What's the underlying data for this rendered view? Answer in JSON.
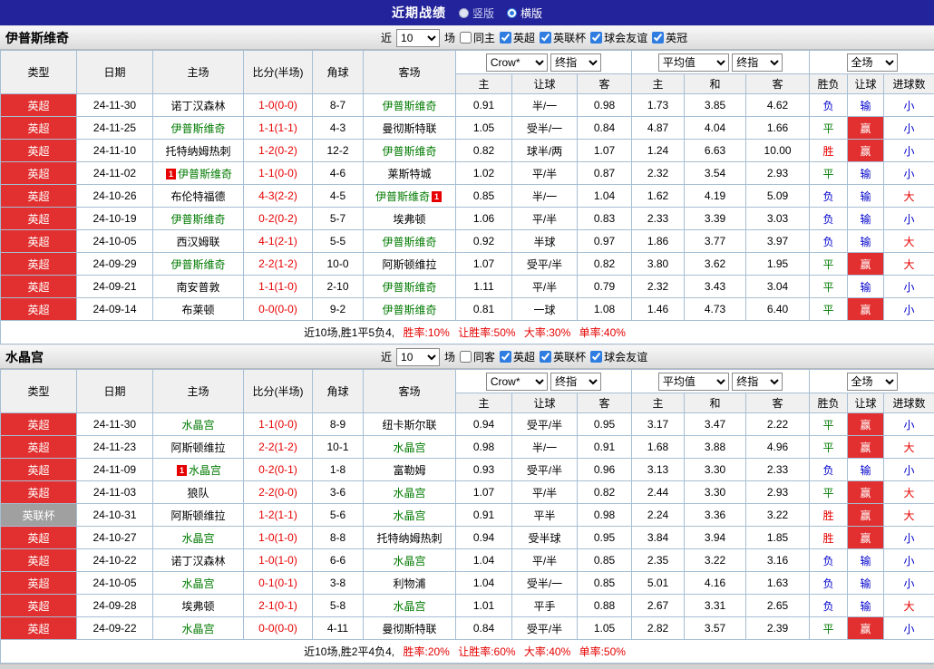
{
  "header": {
    "title": "近期战绩",
    "options": [
      {
        "label": "竖版",
        "selected": false
      },
      {
        "label": "横版",
        "selected": true
      }
    ]
  },
  "columns": [
    "类型",
    "日期",
    "主场",
    "比分(半场)",
    "角球",
    "客场",
    "主",
    "让球",
    "客",
    "主",
    "和",
    "客",
    "胜负",
    "让球",
    "进球数"
  ],
  "sections": [
    {
      "team": "伊普斯维奇",
      "filter": {
        "near_label": "近",
        "count": "10",
        "games_label": "场",
        "same_label": "同主",
        "same_checked": false,
        "leagues": [
          {
            "label": "英超",
            "checked": true
          },
          {
            "label": "英联杯",
            "checked": true
          },
          {
            "label": "球会友谊",
            "checked": true
          },
          {
            "label": "英冠",
            "checked": true
          }
        ]
      },
      "dropdowns": {
        "asia_source": "Crow*",
        "asia_type": "终指",
        "euro_source": "平均值",
        "euro_type": "终指",
        "scope": "全场"
      },
      "rows": [
        {
          "league": "英超",
          "date": "24-11-30",
          "home": "诺丁汉森林",
          "home_subject": false,
          "home_card": false,
          "score": "1-0(0-0)",
          "corner": "8-7",
          "away": "伊普斯维奇",
          "away_subject": true,
          "away_card": false,
          "asia_home": "0.91",
          "handicap": "半/一",
          "asia_away": "0.98",
          "euro_home": "1.73",
          "euro_draw": "3.85",
          "euro_away": "4.62",
          "result": "负",
          "handicap_result": "输",
          "goals": "小"
        },
        {
          "league": "英超",
          "date": "24-11-25",
          "home": "伊普斯维奇",
          "home_subject": true,
          "home_card": false,
          "score": "1-1(1-1)",
          "corner": "4-3",
          "away": "曼彻斯特联",
          "away_subject": false,
          "away_card": false,
          "asia_home": "1.05",
          "handicap": "受半/一",
          "asia_away": "0.84",
          "euro_home": "4.87",
          "euro_draw": "4.04",
          "euro_away": "1.66",
          "result": "平",
          "handicap_result": "赢",
          "goals": "小"
        },
        {
          "league": "英超",
          "date": "24-11-10",
          "home": "托特纳姆热刺",
          "home_subject": false,
          "home_card": false,
          "score": "1-2(0-2)",
          "corner": "12-2",
          "away": "伊普斯维奇",
          "away_subject": true,
          "away_card": false,
          "asia_home": "0.82",
          "handicap": "球半/两",
          "asia_away": "1.07",
          "euro_home": "1.24",
          "euro_draw": "6.63",
          "euro_away": "10.00",
          "result": "胜",
          "handicap_result": "赢",
          "goals": "小"
        },
        {
          "league": "英超",
          "date": "24-11-02",
          "home": "伊普斯维奇",
          "home_subject": true,
          "home_card": true,
          "score": "1-1(0-0)",
          "corner": "4-6",
          "away": "莱斯特城",
          "away_subject": false,
          "away_card": false,
          "asia_home": "1.02",
          "handicap": "平/半",
          "asia_away": "0.87",
          "euro_home": "2.32",
          "euro_draw": "3.54",
          "euro_away": "2.93",
          "result": "平",
          "handicap_result": "输",
          "goals": "小"
        },
        {
          "league": "英超",
          "date": "24-10-26",
          "home": "布伦特福德",
          "home_subject": false,
          "home_card": false,
          "score": "4-3(2-2)",
          "corner": "4-5",
          "away": "伊普斯维奇",
          "away_subject": true,
          "away_card": true,
          "asia_home": "0.85",
          "handicap": "半/一",
          "asia_away": "1.04",
          "euro_home": "1.62",
          "euro_draw": "4.19",
          "euro_away": "5.09",
          "result": "负",
          "handicap_result": "输",
          "goals": "大"
        },
        {
          "league": "英超",
          "date": "24-10-19",
          "home": "伊普斯维奇",
          "home_subject": true,
          "home_card": false,
          "score": "0-2(0-2)",
          "corner": "5-7",
          "away": "埃弗顿",
          "away_subject": false,
          "away_card": false,
          "asia_home": "1.06",
          "handicap": "平/半",
          "asia_away": "0.83",
          "euro_home": "2.33",
          "euro_draw": "3.39",
          "euro_away": "3.03",
          "result": "负",
          "handicap_result": "输",
          "goals": "小"
        },
        {
          "league": "英超",
          "date": "24-10-05",
          "home": "西汉姆联",
          "home_subject": false,
          "home_card": false,
          "score": "4-1(2-1)",
          "corner": "5-5",
          "away": "伊普斯维奇",
          "away_subject": true,
          "away_card": false,
          "asia_home": "0.92",
          "handicap": "半球",
          "asia_away": "0.97",
          "euro_home": "1.86",
          "euro_draw": "3.77",
          "euro_away": "3.97",
          "result": "负",
          "handicap_result": "输",
          "goals": "大"
        },
        {
          "league": "英超",
          "date": "24-09-29",
          "home": "伊普斯维奇",
          "home_subject": true,
          "home_card": false,
          "score": "2-2(1-2)",
          "corner": "10-0",
          "away": "阿斯顿维拉",
          "away_subject": false,
          "away_card": false,
          "asia_home": "1.07",
          "handicap": "受平/半",
          "asia_away": "0.82",
          "euro_home": "3.80",
          "euro_draw": "3.62",
          "euro_away": "1.95",
          "result": "平",
          "handicap_result": "赢",
          "goals": "大"
        },
        {
          "league": "英超",
          "date": "24-09-21",
          "home": "南安普敦",
          "home_subject": false,
          "home_card": false,
          "score": "1-1(1-0)",
          "corner": "2-10",
          "away": "伊普斯维奇",
          "away_subject": true,
          "away_card": false,
          "asia_home": "1.11",
          "handicap": "平/半",
          "asia_away": "0.79",
          "euro_home": "2.32",
          "euro_draw": "3.43",
          "euro_away": "3.04",
          "result": "平",
          "handicap_result": "输",
          "goals": "小"
        },
        {
          "league": "英超",
          "date": "24-09-14",
          "home": "布莱顿",
          "home_subject": false,
          "home_card": false,
          "score": "0-0(0-0)",
          "corner": "9-2",
          "away": "伊普斯维奇",
          "away_subject": true,
          "away_card": false,
          "asia_home": "0.81",
          "handicap": "一球",
          "asia_away": "1.08",
          "euro_home": "1.46",
          "euro_draw": "4.73",
          "euro_away": "6.40",
          "result": "平",
          "handicap_result": "赢",
          "goals": "小"
        }
      ],
      "summary": {
        "prefix": "近10场,胜1平5负4,",
        "win_rate": "胜率:10%",
        "handicap_rate": "让胜率:50%",
        "big_rate": "大率:30%",
        "odd_rate": "单率:40%"
      }
    },
    {
      "team": "水晶宫",
      "filter": {
        "near_label": "近",
        "count": "10",
        "games_label": "场",
        "same_label": "同客",
        "same_checked": false,
        "leagues": [
          {
            "label": "英超",
            "checked": true
          },
          {
            "label": "英联杯",
            "checked": true
          },
          {
            "label": "球会友谊",
            "checked": true
          }
        ]
      },
      "dropdowns": {
        "asia_source": "Crow*",
        "asia_type": "终指",
        "euro_source": "平均值",
        "euro_type": "终指",
        "scope": "全场"
      },
      "rows": [
        {
          "league": "英超",
          "date": "24-11-30",
          "home": "水晶宫",
          "home_subject": true,
          "home_card": false,
          "score": "1-1(0-0)",
          "corner": "8-9",
          "away": "纽卡斯尔联",
          "away_subject": false,
          "away_card": false,
          "asia_home": "0.94",
          "handicap": "受平/半",
          "asia_away": "0.95",
          "euro_home": "3.17",
          "euro_draw": "3.47",
          "euro_away": "2.22",
          "result": "平",
          "handicap_result": "赢",
          "goals": "小"
        },
        {
          "league": "英超",
          "date": "24-11-23",
          "home": "阿斯顿维拉",
          "home_subject": false,
          "home_card": false,
          "score": "2-2(1-2)",
          "corner": "10-1",
          "away": "水晶宫",
          "away_subject": true,
          "away_card": false,
          "asia_home": "0.98",
          "handicap": "半/一",
          "asia_away": "0.91",
          "euro_home": "1.68",
          "euro_draw": "3.88",
          "euro_away": "4.96",
          "result": "平",
          "handicap_result": "赢",
          "goals": "大"
        },
        {
          "league": "英超",
          "date": "24-11-09",
          "home": "水晶宫",
          "home_subject": true,
          "home_card": true,
          "score": "0-2(0-1)",
          "corner": "1-8",
          "away": "富勒姆",
          "away_subject": false,
          "away_card": false,
          "asia_home": "0.93",
          "handicap": "受平/半",
          "asia_away": "0.96",
          "euro_home": "3.13",
          "euro_draw": "3.30",
          "euro_away": "2.33",
          "result": "负",
          "handicap_result": "输",
          "goals": "小"
        },
        {
          "league": "英超",
          "date": "24-11-03",
          "home": "狼队",
          "home_subject": false,
          "home_card": false,
          "score": "2-2(0-0)",
          "corner": "3-6",
          "away": "水晶宫",
          "away_subject": true,
          "away_card": false,
          "asia_home": "1.07",
          "handicap": "平/半",
          "asia_away": "0.82",
          "euro_home": "2.44",
          "euro_draw": "3.30",
          "euro_away": "2.93",
          "result": "平",
          "handicap_result": "赢",
          "goals": "大"
        },
        {
          "league": "英联杯",
          "date": "24-10-31",
          "home": "阿斯顿维拉",
          "home_subject": false,
          "home_card": false,
          "score": "1-2(1-1)",
          "corner": "5-6",
          "away": "水晶宫",
          "away_subject": true,
          "away_card": false,
          "asia_home": "0.91",
          "handicap": "平半",
          "asia_away": "0.98",
          "euro_home": "2.24",
          "euro_draw": "3.36",
          "euro_away": "3.22",
          "result": "胜",
          "handicap_result": "赢",
          "goals": "大"
        },
        {
          "league": "英超",
          "date": "24-10-27",
          "home": "水晶宫",
          "home_subject": true,
          "home_card": false,
          "score": "1-0(1-0)",
          "corner": "8-8",
          "away": "托特纳姆热刺",
          "away_subject": false,
          "away_card": false,
          "asia_home": "0.94",
          "handicap": "受半球",
          "asia_away": "0.95",
          "euro_home": "3.84",
          "euro_draw": "3.94",
          "euro_away": "1.85",
          "result": "胜",
          "handicap_result": "赢",
          "goals": "小"
        },
        {
          "league": "英超",
          "date": "24-10-22",
          "home": "诺丁汉森林",
          "home_subject": false,
          "home_card": false,
          "score": "1-0(1-0)",
          "corner": "6-6",
          "away": "水晶宫",
          "away_subject": true,
          "away_card": false,
          "asia_home": "1.04",
          "handicap": "平/半",
          "asia_away": "0.85",
          "euro_home": "2.35",
          "euro_draw": "3.22",
          "euro_away": "3.16",
          "result": "负",
          "handicap_result": "输",
          "goals": "小"
        },
        {
          "league": "英超",
          "date": "24-10-05",
          "home": "水晶宫",
          "home_subject": true,
          "home_card": false,
          "score": "0-1(0-1)",
          "corner": "3-8",
          "away": "利物浦",
          "away_subject": false,
          "away_card": false,
          "asia_home": "1.04",
          "handicap": "受半/一",
          "asia_away": "0.85",
          "euro_home": "5.01",
          "euro_draw": "4.16",
          "euro_away": "1.63",
          "result": "负",
          "handicap_result": "输",
          "goals": "小"
        },
        {
          "league": "英超",
          "date": "24-09-28",
          "home": "埃弗顿",
          "home_subject": false,
          "home_card": false,
          "score": "2-1(0-1)",
          "corner": "5-8",
          "away": "水晶宫",
          "away_subject": true,
          "away_card": false,
          "asia_home": "1.01",
          "handicap": "平手",
          "asia_away": "0.88",
          "euro_home": "2.67",
          "euro_draw": "3.31",
          "euro_away": "2.65",
          "result": "负",
          "handicap_result": "输",
          "goals": "大"
        },
        {
          "league": "英超",
          "date": "24-09-22",
          "home": "水晶宫",
          "home_subject": true,
          "home_card": false,
          "score": "0-0(0-0)",
          "corner": "4-11",
          "away": "曼彻斯特联",
          "away_subject": false,
          "away_card": false,
          "asia_home": "0.84",
          "handicap": "受平/半",
          "asia_away": "1.05",
          "euro_home": "2.82",
          "euro_draw": "3.57",
          "euro_away": "2.39",
          "result": "平",
          "handicap_result": "赢",
          "goals": "小"
        }
      ],
      "summary": {
        "prefix": "近10场,胜2平4负4,",
        "win_rate": "胜率:20%",
        "handicap_rate": "让胜率:60%",
        "big_rate": "大率:40%",
        "odd_rate": "单率:50%"
      }
    }
  ]
}
